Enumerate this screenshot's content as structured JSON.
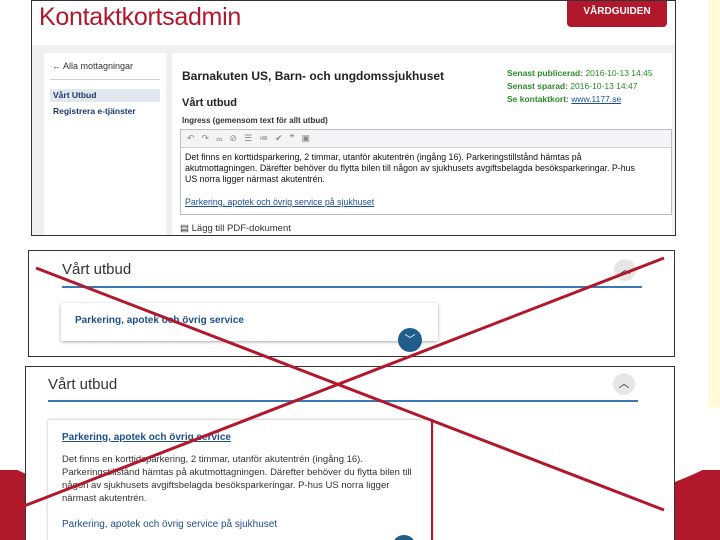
{
  "colors": {
    "brand_red": "#b2182b",
    "link_blue": "#1f4f8a",
    "meta_green": "#2c8a2c",
    "accent_blue": "#3a78b5",
    "cross_red": "#b2182b"
  },
  "admin": {
    "app_title": "Kontaktkortsadmin",
    "brand_badge": "VÅRDGUIDEN",
    "sidebar": {
      "back_link": "Alla mottagningar",
      "items": [
        {
          "label": "Vårt Utbud",
          "active": true
        },
        {
          "label": "Registrera e-tjänster",
          "active": false
        }
      ]
    },
    "unit_title": "Barnakuten US, Barn- och ungdomssjukhuset",
    "meta": {
      "published_label": "Senast publicerad:",
      "published_value": "2016-10-13 14:45",
      "saved_label": "Senast sparad:",
      "saved_value": "2016-10-13 14:47",
      "contact_label": "Se kontaktkort:",
      "contact_link": "www.1177.se"
    },
    "section_title": "Vårt utbud",
    "ingress_label": "Ingress (gemensom text för allt utbud)",
    "toolbar_icons": [
      "undo-icon",
      "redo-icon",
      "link-icon",
      "unlink-icon",
      "bullet-list-icon",
      "numbered-list-icon",
      "spellcheck-icon",
      "quote-icon",
      "source-icon"
    ],
    "editor_text": "Det finns en korttidsparkering, 2 timmar, utanför akutentrén (ingång 16). Parkeringstillstånd hämtas på akutmottagningen. Därefter behöver du flytta bilen till någon av sjukhusets avgiftsbelagda besöksparkeringar. P-hus US norra ligger närmast akutentrén.",
    "editor_link": "Parkering, apotek och övrig service på sjukhuset",
    "add_pdf": "Lägg till PDF-dokument"
  },
  "preview_collapsed": {
    "heading": "Vårt utbud",
    "card_title": "Parkering, apotek och övrig service"
  },
  "preview_expanded": {
    "heading": "Vårt utbud",
    "card_title": "Parkering, apotek och övrig service",
    "card_text": "Det finns en korttidsparkering, 2 timmar, utanför akutentrén (ingång 16). Parkeringstillstånd hämtas på akutmottagningen. Därefter behöver du flytta bilen till någon av sjukhusets avgiftsbelagda besöksparkeringar. P-hus US norra ligger närmast akutentrén.",
    "card_link": "Parkering, apotek och övrig service på sjukhuset"
  }
}
